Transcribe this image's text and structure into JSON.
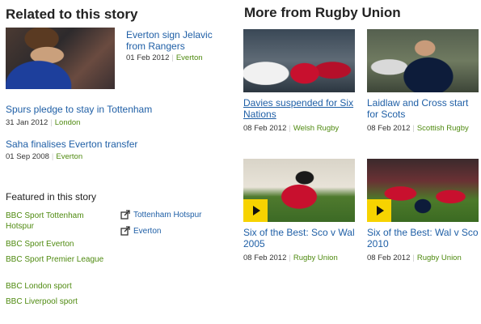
{
  "related": {
    "heading": "Related to this story",
    "lead": {
      "title": "Everton sign Jelavic from Rangers",
      "date": "01 Feb 2012",
      "topic": "Everton",
      "image_icon": "photo-footballer"
    },
    "stories": [
      {
        "title": "Spurs pledge to stay in Tottenham",
        "date": "31 Jan 2012",
        "topic": "London"
      },
      {
        "title": "Saha finalises Everton transfer",
        "date": "01 Sep 2008",
        "topic": "Everton"
      }
    ]
  },
  "featured": {
    "heading": "Featured in this story",
    "bbc_links": [
      "BBC Sport Tottenham Hotspur",
      "BBC Sport Everton",
      "BBC Sport Premier League",
      "BBC London sport",
      "BBC Liverpool sport"
    ],
    "external_links": [
      "Tottenham Hotspur",
      "Everton"
    ],
    "external_icon": "external-link-icon"
  },
  "more": {
    "heading": "More from Rugby Union",
    "cards": [
      {
        "title": "Davies suspended for Six Nations",
        "date": "08 Feb 2012",
        "topic": "Welsh Rugby",
        "video": false
      },
      {
        "title": "Laidlaw and Cross start for Scots",
        "date": "08 Feb 2012",
        "topic": "Scottish Rugby",
        "video": false
      },
      {
        "title": "Six of the Best: Sco v Wal 2005",
        "date": "08 Feb 2012",
        "topic": "Rugby Union",
        "video": true
      },
      {
        "title": "Six of the Best: Wal v Sco 2010",
        "date": "08 Feb 2012",
        "topic": "Rugby Union",
        "video": true
      }
    ]
  },
  "colors": {
    "link": "#1f5fa6",
    "topic": "#4f8a10",
    "play_badge": "#f7d300"
  }
}
